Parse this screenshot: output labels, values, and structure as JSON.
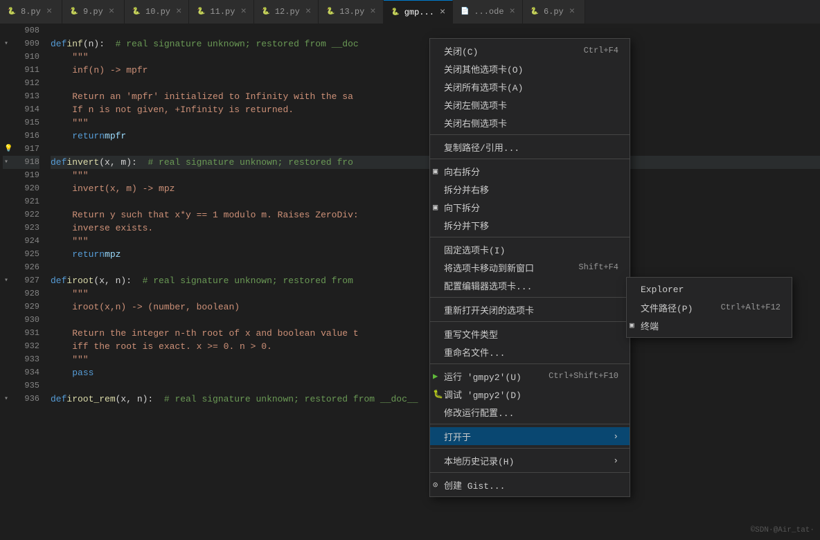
{
  "tabs": [
    {
      "label": "8.py",
      "icon": "🐍",
      "active": false,
      "color": "#e8c877"
    },
    {
      "label": "9.py",
      "icon": "🐍",
      "active": false,
      "color": "#e8c877"
    },
    {
      "label": "10.py",
      "icon": "🐍",
      "active": false,
      "color": "#e8c877"
    },
    {
      "label": "11.py",
      "icon": "🐍",
      "active": false,
      "color": "#e8c877"
    },
    {
      "label": "12.py",
      "icon": "🐍",
      "active": false,
      "color": "#e8c877"
    },
    {
      "label": "13.py",
      "icon": "🐍",
      "active": false,
      "color": "#e8c877"
    },
    {
      "label": "gmp...",
      "icon": "🐍",
      "active": true,
      "color": "#e8c877"
    },
    {
      "label": "...ode",
      "icon": "📄",
      "active": false,
      "color": "#e8c877"
    },
    {
      "label": "6.py",
      "icon": "🐍",
      "active": false,
      "color": "#e8c877"
    }
  ],
  "lines": [
    {
      "num": 908,
      "code": "",
      "fold": false,
      "lightbulb": false,
      "highlight": false
    },
    {
      "num": 909,
      "code": "def inf(n):  # real signature unknown; restored from __doc",
      "fold": true,
      "lightbulb": false,
      "highlight": false
    },
    {
      "num": 910,
      "code": "    \"\"\"",
      "fold": false,
      "lightbulb": false,
      "highlight": false
    },
    {
      "num": 911,
      "code": "    inf(n) -> mpfr",
      "fold": false,
      "lightbulb": false,
      "highlight": false
    },
    {
      "num": 912,
      "code": "",
      "fold": false,
      "lightbulb": false,
      "highlight": false
    },
    {
      "num": 913,
      "code": "    Return an 'mpfr' initialized to Infinity with the sa",
      "fold": false,
      "lightbulb": false,
      "highlight": false
    },
    {
      "num": 914,
      "code": "    If n is not given, +Infinity is returned.",
      "fold": false,
      "lightbulb": false,
      "highlight": false
    },
    {
      "num": 915,
      "code": "    \"\"\"",
      "fold": false,
      "lightbulb": false,
      "highlight": false
    },
    {
      "num": 916,
      "code": "    return mpfr",
      "fold": false,
      "lightbulb": false,
      "highlight": false
    },
    {
      "num": 917,
      "code": "",
      "fold": false,
      "lightbulb": true,
      "highlight": false
    },
    {
      "num": 918,
      "code": "def invert(x, m):  # real signature unknown; restored fro",
      "fold": true,
      "lightbulb": false,
      "highlight": true
    },
    {
      "num": 919,
      "code": "    \"\"\"",
      "fold": false,
      "lightbulb": false,
      "highlight": false
    },
    {
      "num": 920,
      "code": "    invert(x, m) -> mpz",
      "fold": false,
      "lightbulb": false,
      "highlight": false
    },
    {
      "num": 921,
      "code": "",
      "fold": false,
      "lightbulb": false,
      "highlight": false
    },
    {
      "num": 922,
      "code": "    Return y such that x*y == 1 modulo m. Raises ZeroDiv:",
      "fold": false,
      "lightbulb": false,
      "highlight": false
    },
    {
      "num": 923,
      "code": "    inverse exists.",
      "fold": false,
      "lightbulb": false,
      "highlight": false
    },
    {
      "num": 924,
      "code": "    \"\"\"",
      "fold": false,
      "lightbulb": false,
      "highlight": false
    },
    {
      "num": 925,
      "code": "    return mpz",
      "fold": false,
      "lightbulb": false,
      "highlight": false
    },
    {
      "num": 926,
      "code": "",
      "fold": false,
      "lightbulb": false,
      "highlight": false
    },
    {
      "num": 927,
      "code": "def iroot(x, n):  # real signature unknown; restored from",
      "fold": true,
      "lightbulb": false,
      "highlight": false
    },
    {
      "num": 928,
      "code": "    \"\"\"",
      "fold": false,
      "lightbulb": false,
      "highlight": false
    },
    {
      "num": 929,
      "code": "    iroot(x,n) -> (number, boolean)",
      "fold": false,
      "lightbulb": false,
      "highlight": false
    },
    {
      "num": 930,
      "code": "",
      "fold": false,
      "lightbulb": false,
      "highlight": false
    },
    {
      "num": 931,
      "code": "    Return the integer n-th root of x and boolean value t",
      "fold": false,
      "lightbulb": false,
      "highlight": false
    },
    {
      "num": 932,
      "code": "    iff the root is exact. x >= 0. n > 0.",
      "fold": false,
      "lightbulb": false,
      "highlight": false
    },
    {
      "num": 933,
      "code": "    \"\"\"",
      "fold": false,
      "lightbulb": false,
      "highlight": false
    },
    {
      "num": 934,
      "code": "    pass",
      "fold": false,
      "lightbulb": false,
      "highlight": false
    },
    {
      "num": 935,
      "code": "",
      "fold": false,
      "lightbulb": false,
      "highlight": false
    },
    {
      "num": 936,
      "code": "def iroot_rem(x, n):  # real signature unknown; restored from __doc__",
      "fold": true,
      "lightbulb": false,
      "highlight": false
    }
  ],
  "context_menu": {
    "items": [
      {
        "label": "关闭(C)",
        "shortcut": "Ctrl+F4",
        "type": "item",
        "icon": ""
      },
      {
        "label": "关闭其他选项卡(O)",
        "shortcut": "",
        "type": "item",
        "icon": ""
      },
      {
        "label": "关闭所有选项卡(A)",
        "shortcut": "",
        "type": "item",
        "icon": ""
      },
      {
        "label": "关闭左侧选项卡",
        "shortcut": "",
        "type": "item",
        "icon": ""
      },
      {
        "label": "关闭右侧选项卡",
        "shortcut": "",
        "type": "item",
        "icon": ""
      },
      {
        "type": "separator"
      },
      {
        "label": "复制路径/引用...",
        "shortcut": "",
        "type": "item",
        "icon": ""
      },
      {
        "type": "separator"
      },
      {
        "label": "向右拆分",
        "shortcut": "",
        "type": "item",
        "icon": "▣",
        "indent": true
      },
      {
        "label": "拆分并右移",
        "shortcut": "",
        "type": "item",
        "icon": ""
      },
      {
        "label": "向下拆分",
        "shortcut": "",
        "type": "item",
        "icon": "▣",
        "indent": true
      },
      {
        "label": "拆分并下移",
        "shortcut": "",
        "type": "item",
        "icon": ""
      },
      {
        "type": "separator"
      },
      {
        "label": "固定选项卡(I)",
        "shortcut": "",
        "type": "item",
        "icon": ""
      },
      {
        "label": "将选项卡移动到新窗口",
        "shortcut": "Shift+F4",
        "type": "item",
        "icon": ""
      },
      {
        "label": "配置编辑器选项卡...",
        "shortcut": "",
        "type": "item",
        "icon": ""
      },
      {
        "type": "separator"
      },
      {
        "label": "重新打开关闭的选项卡",
        "shortcut": "",
        "type": "item",
        "icon": ""
      },
      {
        "type": "separator"
      },
      {
        "label": "重写文件类型",
        "shortcut": "",
        "type": "item",
        "icon": ""
      },
      {
        "label": "重命名文件...",
        "shortcut": "",
        "type": "item",
        "icon": ""
      },
      {
        "type": "separator"
      },
      {
        "label": "运行 'gmpy2'(U)",
        "shortcut": "Ctrl+Shift+F10",
        "type": "item",
        "icon": "▶"
      },
      {
        "label": "调试 'gmpy2'(D)",
        "shortcut": "",
        "type": "item",
        "icon": "🐛"
      },
      {
        "label": "修改运行配置...",
        "shortcut": "",
        "type": "item",
        "icon": ""
      },
      {
        "type": "separator"
      },
      {
        "label": "打开于",
        "shortcut": "",
        "type": "submenu",
        "icon": ""
      },
      {
        "type": "separator"
      },
      {
        "label": "本地历史记录(H)",
        "shortcut": "",
        "type": "submenu",
        "icon": ""
      },
      {
        "type": "separator"
      },
      {
        "label": "创建 Gist...",
        "shortcut": "",
        "type": "item",
        "icon": "⭕"
      }
    ]
  },
  "submenu": {
    "items": [
      {
        "label": "Explorer",
        "shortcut": ""
      },
      {
        "label": "文件路径(P)",
        "shortcut": "Ctrl+Alt+F12"
      },
      {
        "label": "终端",
        "shortcut": "",
        "icon": "▣"
      }
    ]
  },
  "watermark": "©SDN·@Air_tat·"
}
